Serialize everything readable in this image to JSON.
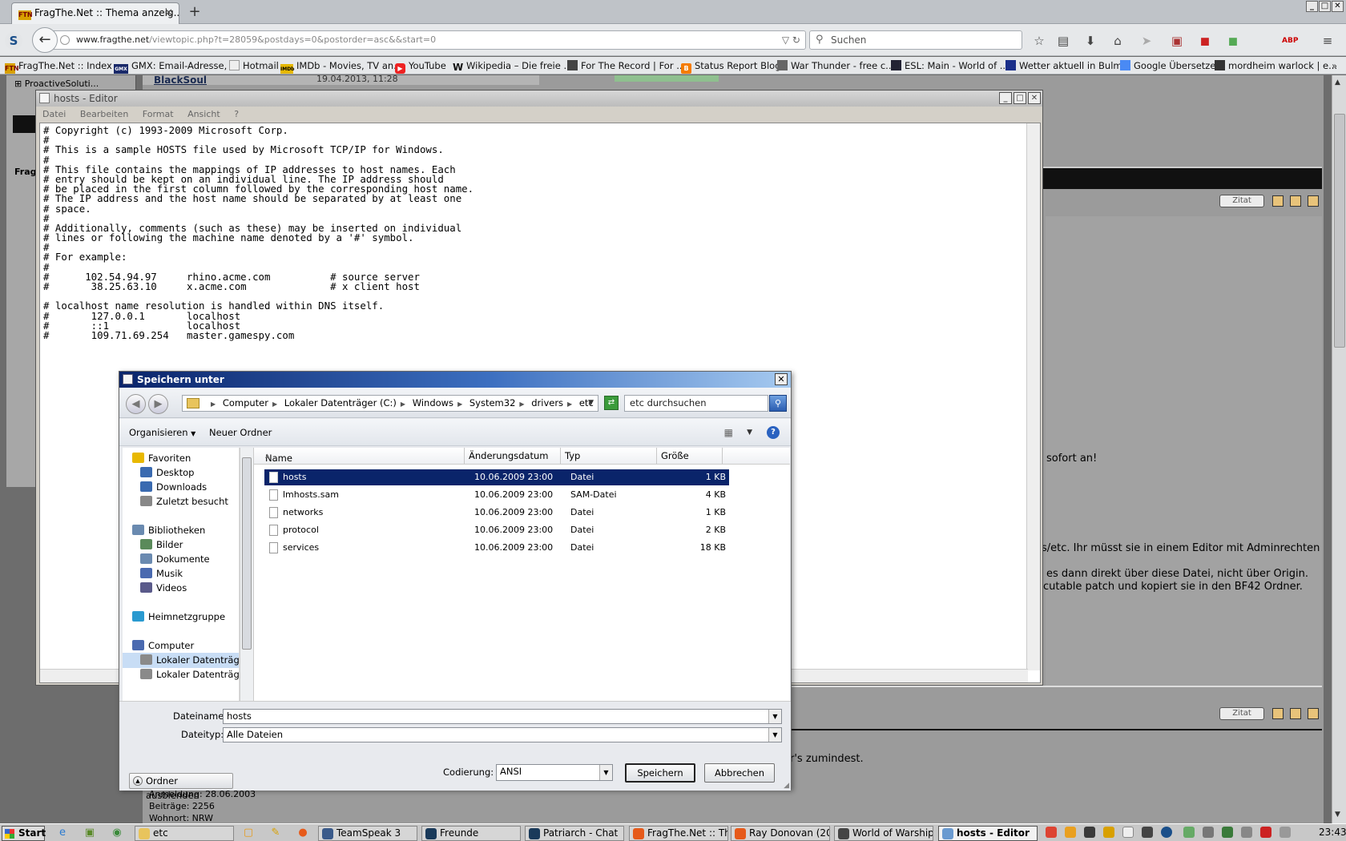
{
  "browser": {
    "tab_title": "FragThe.Net :: Thema anzeig...",
    "tab_favicon": "FTN",
    "url_domain": "www.fragthe.net",
    "url_path": "/viewtopic.php?t=28059&postdays=0&postorder=asc&&start=0",
    "search_placeholder": "Suchen",
    "bookmarks": [
      {
        "label": "FragThe.Net :: Index",
        "icon": "FTN",
        "color": "#d8a000"
      },
      {
        "label": "GMX: Email-Adresse, ...",
        "icon": "GMX",
        "color": "#1a2a6a"
      },
      {
        "label": "Hotmail",
        "icon": "",
        "color": "#e8e8e8"
      },
      {
        "label": "IMDb - Movies, TV an...",
        "icon": "IMDb",
        "color": "#e6b800"
      },
      {
        "label": "YouTube",
        "icon": "▶",
        "color": "#e22"
      },
      {
        "label": "Wikipedia – Die freie ...",
        "icon": "W",
        "color": "#888"
      },
      {
        "label": "For The Record | For ...",
        "icon": "",
        "color": "#444"
      },
      {
        "label": "Status Report Blog",
        "icon": "B",
        "color": "#f57c00"
      },
      {
        "label": "War Thunder - free c...",
        "icon": "",
        "color": "#666"
      },
      {
        "label": "ESL: Main - World of ...",
        "icon": "",
        "color": "#223"
      },
      {
        "label": "Wetter aktuell in Bulm...",
        "icon": "",
        "color": "#1a2f8a"
      },
      {
        "label": "Google Übersetzer",
        "icon": "",
        "color": "#4a8af4"
      },
      {
        "label": "mordheim warlock | e...",
        "icon": "",
        "color": "#333"
      }
    ]
  },
  "forum": {
    "bg_post_name": "BlackSoul",
    "bg_post_date": "19.04.2013, 11:28",
    "left_menu_item": "ProactiveSoluti...",
    "left_title": "Frag",
    "quote_label": "Zitat",
    "text_sofort": "sofort an!",
    "text_line1": "s/etc. Ihr müsst sie in einem Editor mit Adminrechten",
    "text_line2": "es dann direkt über diese Datei, nicht über Origin.",
    "text_line3": "cutable patch und kopiert sie in den BF42 Ordner.",
    "text_zumindest": "r's zumindest.",
    "profile_reg": "Anmeldung: 28.06.2003",
    "profile_posts": "Beiträge: 2256",
    "profile_loc": "Wohnort: NRW"
  },
  "notepad": {
    "title": "hosts - Editor",
    "menu": [
      "Datei",
      "Bearbeiten",
      "Format",
      "Ansicht",
      "?"
    ],
    "lines": [
      "# Copyright (c) 1993-2009 Microsoft Corp.",
      "#",
      "# This is a sample HOSTS file used by Microsoft TCP/IP for Windows.",
      "#",
      "# This file contains the mappings of IP addresses to host names. Each",
      "# entry should be kept on an individual line. The IP address should",
      "# be placed in the first column followed by the corresponding host name.",
      "# The IP address and the host name should be separated by at least one",
      "# space.",
      "#",
      "# Additionally, comments (such as these) may be inserted on individual",
      "# lines or following the machine name denoted by a '#' symbol.",
      "#",
      "# For example:",
      "#",
      "#      102.54.94.97     rhino.acme.com          # source server",
      "#       38.25.63.10     x.acme.com              # x client host",
      "",
      "# localhost name resolution is handled within DNS itself.",
      "#       127.0.0.1       localhost",
      "#       ::1             localhost",
      "#       109.71.69.254   master.gamespy.com"
    ]
  },
  "save_dialog": {
    "title": "Speichern unter",
    "breadcrumb": [
      "Computer",
      "Lokaler Datenträger (C:)",
      "Windows",
      "System32",
      "drivers",
      "etc"
    ],
    "search_placeholder": "etc durchsuchen",
    "organize_label": "Organisieren",
    "new_folder_label": "Neuer Ordner",
    "tree": [
      {
        "label": "Favoriten",
        "icon": "star-icon",
        "color": "#e8b800",
        "indent": 0
      },
      {
        "label": "Desktop",
        "icon": "desktop-icon",
        "color": "#3a6ab0",
        "indent": 1
      },
      {
        "label": "Downloads",
        "icon": "downloads-icon",
        "color": "#3a6ab0",
        "indent": 1
      },
      {
        "label": "Zuletzt besucht",
        "icon": "recent-icon",
        "color": "#888",
        "indent": 1
      },
      {
        "label": "",
        "icon": "",
        "color": "",
        "indent": 0
      },
      {
        "label": "Bibliotheken",
        "icon": "library-icon",
        "color": "#6a8ab0",
        "indent": 0
      },
      {
        "label": "Bilder",
        "icon": "pictures-icon",
        "color": "#5a8a5a",
        "indent": 1
      },
      {
        "label": "Dokumente",
        "icon": "documents-icon",
        "color": "#6a8ab0",
        "indent": 1
      },
      {
        "label": "Musik",
        "icon": "music-icon",
        "color": "#4a6ab0",
        "indent": 1
      },
      {
        "label": "Videos",
        "icon": "videos-icon",
        "color": "#5a5a8a",
        "indent": 1
      },
      {
        "label": "",
        "icon": "",
        "color": "",
        "indent": 0
      },
      {
        "label": "Heimnetzgruppe",
        "icon": "homegroup-icon",
        "color": "#2a9ad0",
        "indent": 0
      },
      {
        "label": "",
        "icon": "",
        "color": "",
        "indent": 0
      },
      {
        "label": "Computer",
        "icon": "computer-icon",
        "color": "#4a6ab0",
        "indent": 0
      },
      {
        "label": "Lokaler Datenträge",
        "icon": "drive-icon",
        "color": "#8a8a8a",
        "indent": 1
      },
      {
        "label": "Lokaler Datenträge",
        "icon": "drive-icon",
        "color": "#8a8a8a",
        "indent": 1
      }
    ],
    "columns": [
      "Name",
      "Änderungsdatum",
      "Typ",
      "Größe"
    ],
    "files": [
      {
        "name": "hosts",
        "date": "10.06.2009 23:00",
        "type": "Datei",
        "size": "1 KB",
        "selected": true
      },
      {
        "name": "lmhosts.sam",
        "date": "10.06.2009 23:00",
        "type": "SAM-Datei",
        "size": "4 KB",
        "selected": false
      },
      {
        "name": "networks",
        "date": "10.06.2009 23:00",
        "type": "Datei",
        "size": "1 KB",
        "selected": false
      },
      {
        "name": "protocol",
        "date": "10.06.2009 23:00",
        "type": "Datei",
        "size": "2 KB",
        "selected": false
      },
      {
        "name": "services",
        "date": "10.06.2009 23:00",
        "type": "Datei",
        "size": "18 KB",
        "selected": false
      }
    ],
    "filename_label": "Dateiname:",
    "filename_value": "hosts",
    "filetype_label": "Dateityp:",
    "filetype_value": "Alle Dateien",
    "encoding_label": "Codierung:",
    "encoding_value": "ANSI",
    "save_label": "Speichern",
    "cancel_label": "Abbrechen",
    "hide_folders_label": "Ordner ausblenden"
  },
  "taskbar": {
    "start_label": "Start",
    "tasks": [
      {
        "label": "etc",
        "color": "#e8c45c",
        "active": false
      },
      {
        "label": "TeamSpeak 3",
        "color": "#3a5a8a",
        "active": false
      },
      {
        "label": "Freunde",
        "color": "#1a3a5a",
        "active": false
      },
      {
        "label": "Patriarch - Chat",
        "color": "#1a3a5a",
        "active": false
      },
      {
        "label": "FragThe.Net :: Th...",
        "color": "#e65a1a",
        "active": false
      },
      {
        "label": "Ray Donovan (20...",
        "color": "#e65a1a",
        "active": false
      },
      {
        "label": "World of Warships",
        "color": "#444",
        "active": false
      },
      {
        "label": "hosts - Editor",
        "color": "#6a9ad0",
        "active": true
      }
    ],
    "clock": "23:43"
  }
}
